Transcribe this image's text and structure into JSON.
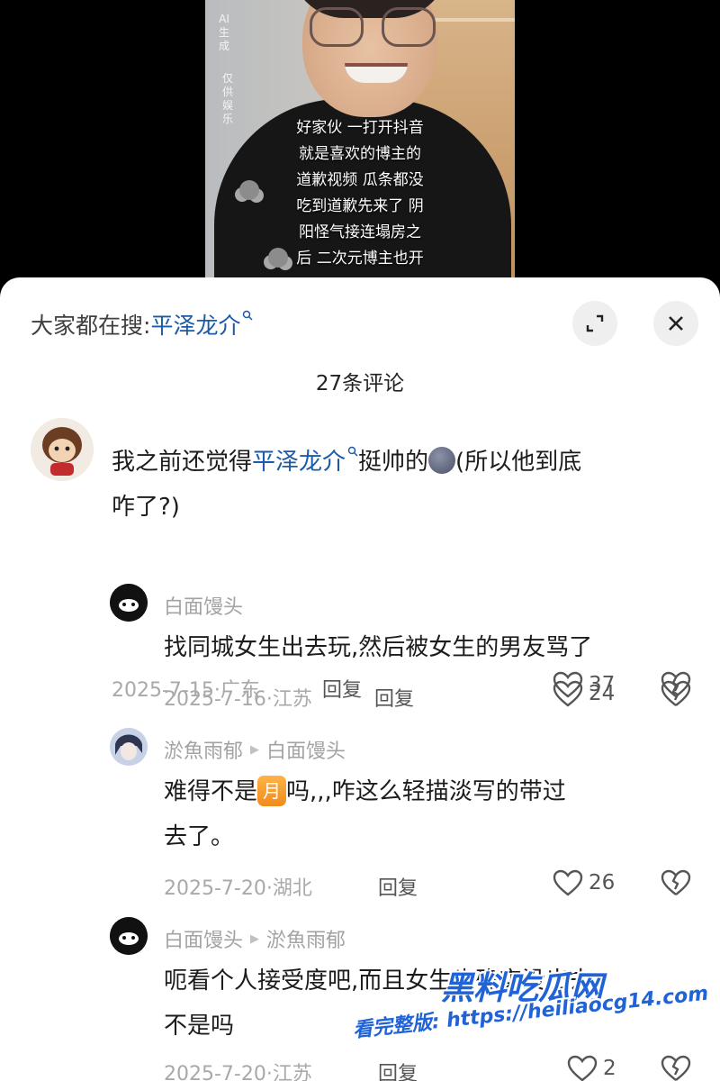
{
  "video": {
    "ai_tag": "AI生成",
    "ai_tag_2": "仅供娱乐",
    "caption_lines": [
      "好家伙 一打开抖音",
      "就是喜欢的博主的",
      "道歉视频 瓜条都没",
      "吃到道歉先来了 阴",
      "阳怪气接连塌房之",
      "后 二次元博主也开"
    ]
  },
  "search": {
    "prefix": "大家都在搜:",
    "keyword": "平泽龙介"
  },
  "header": {
    "comment_count": "27条评论"
  },
  "comments": [
    {
      "text_before": "我之前还觉得",
      "text_link": "平泽龙介",
      "text_mid": "挺帅的",
      "text_after": "(所以他到底",
      "text_line2": "咋了?)",
      "date_loc": "2025-7-15·广东",
      "reply_label": "回复",
      "likes": "37"
    },
    {
      "user": "白面馒头",
      "text": "找同城女生出去玩,然后被女生的男友骂了",
      "date_loc": "2025-7-16·江苏",
      "reply_label": "回复",
      "likes": "24"
    },
    {
      "user": "淤魚雨郁",
      "reply_to": "白面馒头",
      "text_before": "难得不是",
      "badge": "月",
      "text_after": "吗,,,咋这么轻描淡写的带过",
      "text_line2": "去了。",
      "date_loc": "2025-7-20·湖北",
      "reply_label": "回复",
      "likes": "26"
    },
    {
      "user": "白面馒头",
      "reply_to": "淤魚雨郁",
      "text_line1": "呃看个人接受度吧,而且女生也确实没出去",
      "text_line2": "不是吗",
      "date_loc": "2025-7-20·江苏",
      "reply_label": "回复",
      "likes": "2"
    }
  ],
  "watermark": {
    "title": "黑料吃瓜网",
    "url_line": "看完整版: https://heiliaocg14.com"
  }
}
